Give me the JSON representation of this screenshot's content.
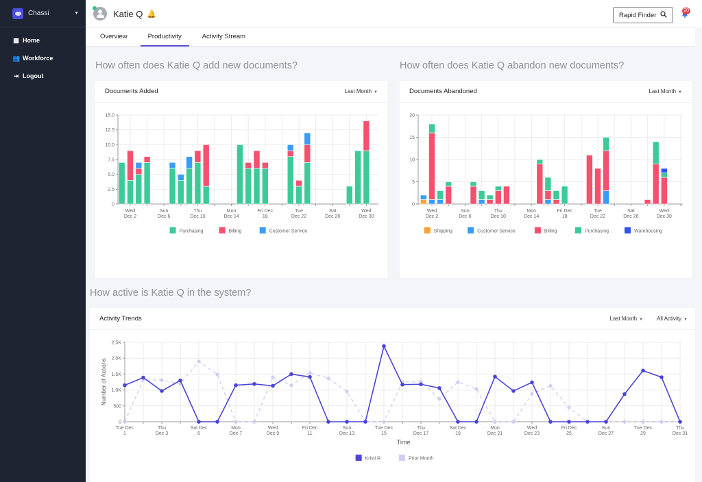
{
  "sidebar": {
    "brand": "Chassi",
    "items": [
      {
        "label": "Home",
        "icon": "dashboard-icon"
      },
      {
        "label": "Workforce",
        "icon": "users-icon"
      },
      {
        "label": "Logout",
        "icon": "logout-icon"
      }
    ]
  },
  "header": {
    "user_name": "Katie Q",
    "finder_label": "Rapid Finder",
    "notification_count": "20"
  },
  "tabs": [
    {
      "label": "Overview",
      "active": false
    },
    {
      "label": "Productivity",
      "active": true
    },
    {
      "label": "Activity Stream",
      "active": false
    }
  ],
  "sections": {
    "added_question": "How often does Katie Q add new documents?",
    "abandoned_question": "How often does Katie Q abandon new documents?",
    "activity_question": "How active is Katie Q in the system?"
  },
  "cards": {
    "added": {
      "title": "Documents Added",
      "range": "Last Month"
    },
    "abandoned": {
      "title": "Documents Abandoned",
      "range": "Last Month"
    },
    "activity": {
      "title": "Activity Trends",
      "range": "Last Month",
      "filter": "All Activity"
    }
  },
  "colors": {
    "purchasing": "#3ccb98",
    "billing": "#f5506e",
    "customer_service": "#3a9cf7",
    "shipping": "#f6a43a",
    "warehousing": "#3352ec",
    "kristi": "#4a45d8",
    "prior": "#cfcdf7",
    "accent": "#5b50d8"
  },
  "chart_data": [
    {
      "type": "bar",
      "stacked": true,
      "title": "Documents Added",
      "xlabel": "",
      "ylabel": "",
      "ylim": [
        0,
        15
      ],
      "yticks": [
        "0",
        "2.5",
        "5.0",
        "7.5",
        "10.0",
        "12.5",
        "15.0"
      ],
      "xticks": [
        {
          "day": 2,
          "l1": "Wed",
          "l2": "Dec 2"
        },
        {
          "day": 6,
          "l1": "Sun",
          "l2": "Dec 6"
        },
        {
          "day": 10,
          "l1": "Thu",
          "l2": "Dec 10"
        },
        {
          "day": 14,
          "l1": "Mon",
          "l2": "Dec 14"
        },
        {
          "day": 18,
          "l1": "Fri Dec",
          "l2": "18"
        },
        {
          "day": 22,
          "l1": "Tue",
          "l2": "Dec 22"
        },
        {
          "day": 26,
          "l1": "Sat",
          "l2": "Dec 26"
        },
        {
          "day": 30,
          "l1": "Wed",
          "l2": "Dec 30"
        }
      ],
      "days": [
        1,
        2,
        3,
        4,
        7,
        8,
        9,
        10,
        11,
        15,
        16,
        17,
        18,
        21,
        22,
        23,
        28,
        29,
        30
      ],
      "series": [
        {
          "name": "Purchasing",
          "key": "purchasing",
          "values": [
            7,
            4,
            5,
            7,
            6,
            4,
            6,
            7,
            3,
            10,
            6,
            6,
            6,
            8,
            3,
            7,
            3,
            9,
            9
          ]
        },
        {
          "name": "Billing",
          "key": "billing",
          "values": [
            0,
            5,
            1,
            1,
            0,
            0,
            0,
            2,
            7,
            0,
            1,
            3,
            1,
            1,
            1,
            3,
            0,
            0,
            5
          ]
        },
        {
          "name": "Customer Service",
          "key": "customer_service",
          "values": [
            0,
            0,
            1,
            0,
            1,
            1,
            2,
            0,
            0,
            0,
            0,
            0,
            0,
            1,
            0,
            2,
            0,
            0,
            0
          ]
        }
      ],
      "legend": "bottom"
    },
    {
      "type": "bar",
      "stacked": true,
      "title": "Documents Abandoned",
      "xlabel": "",
      "ylabel": "",
      "ylim": [
        0,
        20
      ],
      "yticks": [
        "0",
        "5",
        "10",
        "15",
        "20"
      ],
      "xticks": [
        {
          "day": 2,
          "l1": "Wed",
          "l2": "Dec 2"
        },
        {
          "day": 6,
          "l1": "Sun",
          "l2": "Dec 6"
        },
        {
          "day": 10,
          "l1": "Thu",
          "l2": "Dec 10"
        },
        {
          "day": 14,
          "l1": "Mon",
          "l2": "Dec 14"
        },
        {
          "day": 18,
          "l1": "Fri Dec",
          "l2": "18"
        },
        {
          "day": 22,
          "l1": "Tue",
          "l2": "Dec 22"
        },
        {
          "day": 26,
          "l1": "Sat",
          "l2": "Dec 26"
        },
        {
          "day": 30,
          "l1": "Wed",
          "l2": "Dec 30"
        }
      ],
      "days": [
        1,
        2,
        3,
        4,
        7,
        8,
        9,
        10,
        11,
        15,
        16,
        17,
        18,
        21,
        22,
        23,
        28,
        29,
        30
      ],
      "series": [
        {
          "name": "Shipping",
          "key": "shipping",
          "values": [
            1,
            0,
            0,
            0,
            0,
            0,
            0,
            0,
            0,
            0,
            0,
            0,
            0,
            0,
            0,
            0,
            0,
            0,
            0
          ]
        },
        {
          "name": "Customer Service",
          "key": "customer_service",
          "values": [
            1,
            1,
            1,
            0,
            0,
            1,
            0,
            0,
            0,
            0,
            1,
            0,
            0,
            0,
            0,
            3,
            0,
            0,
            0
          ]
        },
        {
          "name": "Billing",
          "key": "billing",
          "values": [
            0,
            15,
            0,
            4,
            4,
            0,
            1,
            3,
            4,
            9,
            2,
            1,
            0,
            11,
            8,
            9,
            1,
            9,
            6
          ]
        },
        {
          "name": "Purchasing",
          "key": "purchasing",
          "values": [
            0,
            2,
            2,
            1,
            1,
            2,
            1,
            1,
            0,
            1,
            3,
            2,
            4,
            0,
            0,
            3,
            0,
            5,
            1
          ]
        },
        {
          "name": "Warehousing",
          "key": "warehousing",
          "values": [
            0,
            0,
            0,
            0,
            0,
            0,
            0,
            0,
            0,
            0,
            0,
            0,
            0,
            0,
            0,
            0,
            0,
            0,
            1
          ]
        }
      ],
      "legend": "bottom"
    },
    {
      "type": "line",
      "title": "Activity Trends",
      "xlabel": "Time",
      "ylabel": "Number of Actions",
      "ylim": [
        0,
        2500
      ],
      "yticks": [
        "0",
        "500",
        "1.0K",
        "1.5K",
        "2.0K",
        "2.5K"
      ],
      "xticks": [
        {
          "day": 1,
          "l1": "Tue Dec",
          "l2": "1"
        },
        {
          "day": 3,
          "l1": "Thu",
          "l2": "Dec 3"
        },
        {
          "day": 5,
          "l1": "Sat Dec",
          "l2": "5"
        },
        {
          "day": 7,
          "l1": "Mon",
          "l2": "Dec 7"
        },
        {
          "day": 9,
          "l1": "Wed",
          "l2": "Dec 9"
        },
        {
          "day": 11,
          "l1": "Fri Dec",
          "l2": "11"
        },
        {
          "day": 13,
          "l1": "Sun",
          "l2": "Dec 13"
        },
        {
          "day": 15,
          "l1": "Tue Dec",
          "l2": "15"
        },
        {
          "day": 17,
          "l1": "Thu",
          "l2": "Dec 17"
        },
        {
          "day": 19,
          "l1": "Sat Dec",
          "l2": "19"
        },
        {
          "day": 21,
          "l1": "Mon",
          "l2": "Dec 21"
        },
        {
          "day": 23,
          "l1": "Wed",
          "l2": "Dec 23"
        },
        {
          "day": 25,
          "l1": "Fri Dec",
          "l2": "25"
        },
        {
          "day": 27,
          "l1": "Sun",
          "l2": "Dec 27"
        },
        {
          "day": 29,
          "l1": "Tue Dec",
          "l2": "29"
        },
        {
          "day": 31,
          "l1": "Thu",
          "l2": "Dec 31"
        }
      ],
      "x": [
        1,
        2,
        3,
        4,
        5,
        6,
        7,
        8,
        9,
        10,
        11,
        12,
        13,
        14,
        15,
        16,
        17,
        18,
        19,
        20,
        21,
        22,
        23,
        24,
        25,
        26,
        27,
        28,
        29,
        30,
        31
      ],
      "series": [
        {
          "name": "Kristi R",
          "key": "kristi",
          "style": "solid",
          "values": [
            1150,
            1390,
            970,
            1300,
            0,
            0,
            1150,
            1190,
            1130,
            1500,
            1410,
            0,
            0,
            0,
            2380,
            1170,
            1180,
            1060,
            0,
            0,
            1420,
            970,
            1240,
            0,
            0,
            0,
            0,
            870,
            1610,
            1400,
            0
          ]
        },
        {
          "name": "Prior Month",
          "key": "prior",
          "style": "dashed",
          "values": [
            0,
            1320,
            1310,
            1200,
            1900,
            1490,
            0,
            0,
            1400,
            1150,
            1540,
            1370,
            950,
            0,
            0,
            1250,
            1260,
            720,
            1250,
            1030,
            0,
            0,
            880,
            1130,
            450,
            0,
            0,
            0,
            0,
            0,
            0
          ]
        }
      ],
      "legend": "bottom"
    }
  ]
}
